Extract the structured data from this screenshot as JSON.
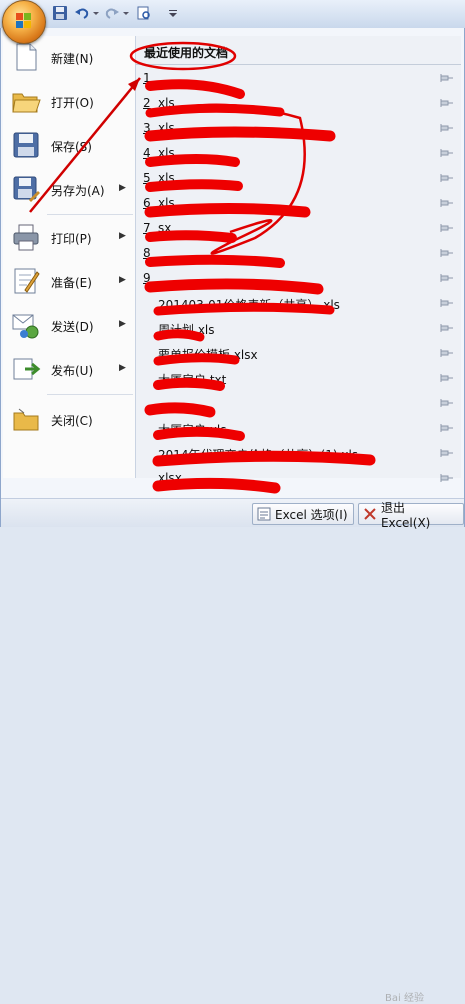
{
  "quick_access": {
    "icons": [
      "office-logo-icon",
      "save-icon",
      "undo-icon",
      "redo-icon",
      "print-preview-icon",
      "customize-icon"
    ]
  },
  "commands": [
    {
      "label": "新建(N)",
      "icon": "new-document-icon",
      "has_submenu": false
    },
    {
      "label": "打开(O)",
      "icon": "open-folder-icon",
      "has_submenu": false
    },
    {
      "label": "保存(S)",
      "icon": "floppy-disk-icon",
      "has_submenu": false
    },
    {
      "label": "另存为(A)",
      "icon": "save-as-icon",
      "has_submenu": true
    },
    {
      "label": "打印(P)",
      "icon": "printer-icon",
      "has_submenu": true
    },
    {
      "label": "准备(E)",
      "icon": "prepare-icon",
      "has_submenu": true
    },
    {
      "label": "发送(D)",
      "icon": "send-icon",
      "has_submenu": true
    },
    {
      "label": "发布(U)",
      "icon": "publish-icon",
      "has_submenu": true
    },
    {
      "label": "关闭(C)",
      "icon": "close-folder-icon",
      "has_submenu": false
    }
  ],
  "recent": {
    "title": "最近使用的文档",
    "items": [
      {
        "num": "1",
        "name": ""
      },
      {
        "num": "2",
        "name": "xls"
      },
      {
        "num": "3",
        "name": "xls"
      },
      {
        "num": "4",
        "name": "xls"
      },
      {
        "num": "5",
        "name": "xls"
      },
      {
        "num": "6",
        "name": "xls"
      },
      {
        "num": "7",
        "name": "sx"
      },
      {
        "num": "8",
        "name": ""
      },
      {
        "num": "9",
        "name": ""
      },
      {
        "num": "",
        "name": "201403-01价格表新（共享）.xls"
      },
      {
        "num": "",
        "name": "周计划.xls"
      },
      {
        "num": "",
        "name": "要单报价模板.xlsx"
      },
      {
        "num": "",
        "name": "大厦房户.txt"
      },
      {
        "num": "",
        "name": ""
      },
      {
        "num": "",
        "name": "大厦房户.xls"
      },
      {
        "num": "",
        "name": "2014年代理商户价格（共享）(1).xls"
      },
      {
        "num": "",
        "name": "xlsx"
      }
    ]
  },
  "bottom": {
    "options_label": "Excel 选项(I)",
    "exit_label": "退出 Excel(X)"
  },
  "watermark": "Bai 经验",
  "colors": {
    "annotation": "#e00000",
    "header": "#1f1f1f"
  }
}
